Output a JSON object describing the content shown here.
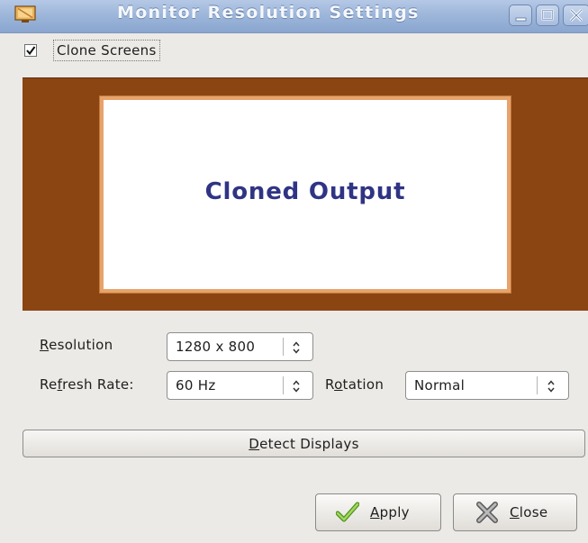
{
  "window": {
    "title": "Monitor Resolution Settings"
  },
  "clone": {
    "label": "Clone Screens",
    "checked": true
  },
  "preview": {
    "label": "Cloned Output",
    "background_color": "#8b4513",
    "screen_border_color": "#e6a36b",
    "label_color": "#2f3484"
  },
  "resolution": {
    "label_accel": "R",
    "label_rest": "esolution",
    "value": "1280 x 800"
  },
  "refresh_rate": {
    "label_pre": "Re",
    "label_accel": "f",
    "label_rest": "resh Rate:",
    "value": "60 Hz"
  },
  "rotation": {
    "label_pre": "R",
    "label_accel": "o",
    "label_rest": "tation",
    "value": "Normal"
  },
  "detect": {
    "label_accel": "D",
    "label_rest": "etect Displays"
  },
  "buttons": {
    "apply_accel": "A",
    "apply_rest": "pply",
    "close_accel": "C",
    "close_rest": "lose"
  },
  "icons": {
    "app": "monitor-app-icon",
    "minimize": "minimize-icon",
    "maximize": "maximize-icon",
    "close": "close-icon",
    "apply": "checkmark-icon",
    "cancel": "x-mark-icon",
    "spinner": "updown-arrows-icon"
  }
}
